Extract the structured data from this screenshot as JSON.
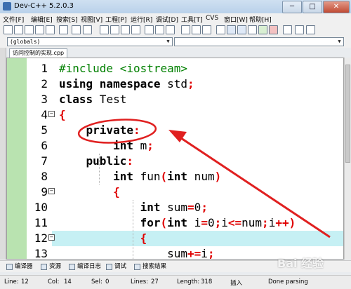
{
  "window": {
    "title": "Dev-C++ 5.2.0.3",
    "buttons": [
      "─",
      "□",
      "✕"
    ]
  },
  "menu": [
    "文件[F]",
    "编辑[E]",
    "搜索[S]",
    "视图[V]",
    "工程[P]",
    "运行[R]",
    "调试[D]",
    "工具[T]",
    "CVS",
    "窗口[W]",
    "帮助[H]"
  ],
  "toolbar": {
    "icons": [
      "new-file-icon",
      "open-file-icon",
      "save-icon",
      "save-all-icon",
      "close-icon",
      "print-icon",
      "undo-icon",
      "redo-icon",
      "find-icon",
      "replace-icon",
      "find-next-icon",
      "goto-line-icon",
      "indent-icon",
      "unindent-icon",
      "toggle-comment-icon",
      "new-project-icon",
      "project-options-icon",
      "class-browser-icon",
      "compile-icon",
      "run-icon",
      "compile-run-icon",
      "rebuild-icon",
      "check-icon",
      "stop-icon",
      "insert-icon",
      "toggle-bookmark-icon",
      "goto-bookmark-icon"
    ]
  },
  "combos": {
    "scope": "(globals)",
    "symbol": ""
  },
  "file_tab": "访问控制的实现.cpp",
  "editor": {
    "highlight_line": 12,
    "lines": [
      {
        "no": "1",
        "fold": "",
        "tokens": [
          [
            "pp",
            "#include <iostream>"
          ]
        ]
      },
      {
        "no": "2",
        "fold": "",
        "tokens": [
          [
            "kw",
            "using namespace"
          ],
          [
            "id",
            " std"
          ],
          [
            "sym",
            ";"
          ]
        ]
      },
      {
        "no": "3",
        "fold": "",
        "tokens": [
          [
            "kw",
            "class"
          ],
          [
            "id",
            " Test"
          ]
        ]
      },
      {
        "no": "4",
        "fold": "⊟",
        "tokens": [
          [
            "sym",
            "{"
          ]
        ]
      },
      {
        "no": "5",
        "fold": "",
        "tokens": [
          [
            "id",
            "    "
          ],
          [
            "kw",
            "private"
          ],
          [
            "sym",
            ":"
          ]
        ]
      },
      {
        "no": "6",
        "fold": "",
        "tokens": [
          [
            "id",
            "        "
          ],
          [
            "kw",
            "int"
          ],
          [
            "id",
            " m"
          ],
          [
            "sym",
            ";"
          ]
        ]
      },
      {
        "no": "7",
        "fold": "",
        "tokens": [
          [
            "id",
            "    "
          ],
          [
            "kw",
            "public"
          ],
          [
            "sym",
            ":"
          ]
        ]
      },
      {
        "no": "8",
        "fold": "",
        "tokens": [
          [
            "id",
            "        "
          ],
          [
            "kw",
            "int"
          ],
          [
            "id",
            " fun"
          ],
          [
            "sym",
            "("
          ],
          [
            "kw",
            "int"
          ],
          [
            "id",
            " num"
          ],
          [
            "sym",
            ")"
          ]
        ]
      },
      {
        "no": "9",
        "fold": "⊟",
        "tokens": [
          [
            "id",
            "        "
          ],
          [
            "sym",
            "{"
          ]
        ]
      },
      {
        "no": "10",
        "fold": "",
        "tokens": [
          [
            "id",
            "            "
          ],
          [
            "kw",
            "int"
          ],
          [
            "id",
            " sum"
          ],
          [
            "sym",
            "="
          ],
          [
            "num",
            "0"
          ],
          [
            "sym",
            ";"
          ]
        ]
      },
      {
        "no": "11",
        "fold": "",
        "tokens": [
          [
            "id",
            "            "
          ],
          [
            "kw",
            "for"
          ],
          [
            "sym",
            "("
          ],
          [
            "kw",
            "int"
          ],
          [
            "id",
            " i"
          ],
          [
            "sym",
            "="
          ],
          [
            "num",
            "0"
          ],
          [
            "sym",
            ";"
          ],
          [
            "id",
            "i"
          ],
          [
            "sym",
            "<="
          ],
          [
            "id",
            "num"
          ],
          [
            "sym",
            ";"
          ],
          [
            "id",
            "i"
          ],
          [
            "sym",
            "++)"
          ]
        ]
      },
      {
        "no": "12",
        "fold": "⊟",
        "tokens": [
          [
            "id",
            "            "
          ],
          [
            "sym",
            "{"
          ]
        ]
      },
      {
        "no": "13",
        "fold": "",
        "tokens": [
          [
            "id",
            "                "
          ],
          [
            "id",
            "sum"
          ],
          [
            "sym",
            "+="
          ],
          [
            "id",
            "i"
          ],
          [
            "sym",
            ";"
          ]
        ]
      }
    ]
  },
  "bottom_tabs": [
    {
      "label": "编译器",
      "icon": "compiler-icon"
    },
    {
      "label": "资源",
      "icon": "resources-icon"
    },
    {
      "label": "编译日志",
      "icon": "compile-log-icon"
    },
    {
      "label": "调试",
      "icon": "debug-icon"
    },
    {
      "label": "搜索结果",
      "icon": "search-results-icon"
    }
  ],
  "status": {
    "line_label": "Line:",
    "line_value": "12",
    "col_label": "Col:",
    "col_value": "14",
    "sel_label": "Sel:",
    "sel_value": "0",
    "lines_label": "Lines:",
    "lines_value": "27",
    "length_label": "Length:",
    "length_value": "318",
    "mode": "插入",
    "message": "Done parsing"
  },
  "annotation_color": "#e02020",
  "watermark": "Bai 经验"
}
